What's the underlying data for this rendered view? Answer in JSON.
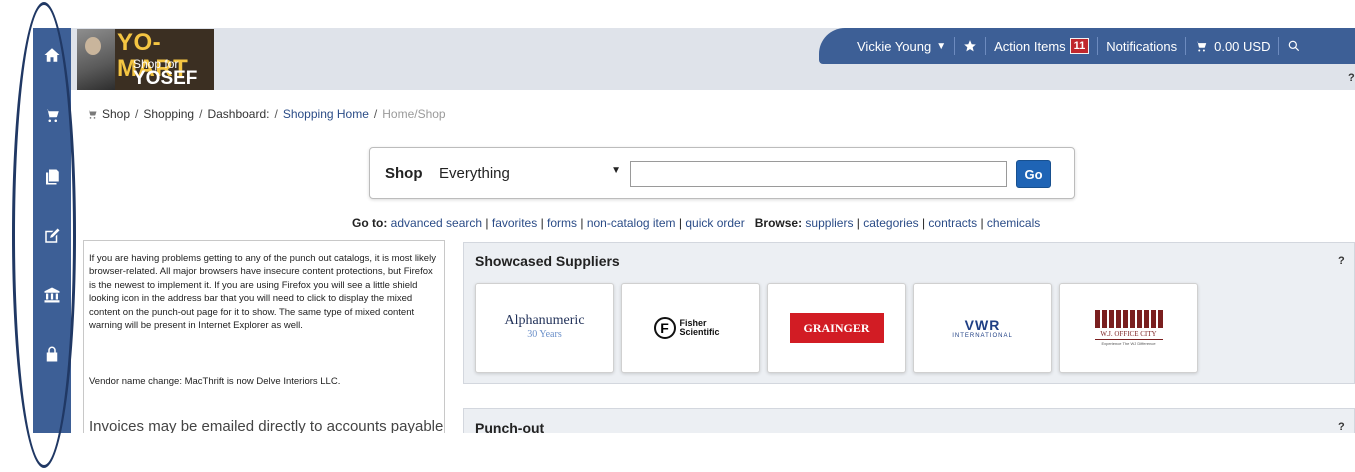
{
  "header": {
    "logo": {
      "title": "YO-MART",
      "subtitle": "Shop for",
      "name": "YOSEF"
    },
    "user_bar": {
      "user_name": "Vickie Young",
      "action_items_label": "Action Items",
      "action_items_count": "11",
      "notifications_label": "Notifications",
      "cart_total": "0.00 USD"
    },
    "help": "?"
  },
  "sidebar": {
    "items": [
      {
        "name": "home",
        "icon": "home-icon"
      },
      {
        "name": "shop",
        "icon": "cart-icon"
      },
      {
        "name": "documents",
        "icon": "documents-icon"
      },
      {
        "name": "approvals",
        "icon": "edit-icon"
      },
      {
        "name": "accounts-payable",
        "icon": "bank-icon"
      },
      {
        "name": "setup",
        "icon": "lock-icon"
      }
    ]
  },
  "breadcrumb": {
    "shop": "Shop",
    "shopping": "Shopping",
    "dashboard": "Dashboard:",
    "shopping_home": "Shopping Home",
    "current": "Home/Shop"
  },
  "search": {
    "label": "Shop",
    "category": "Everything",
    "query": "",
    "go_label": "Go"
  },
  "goto": {
    "label": "Go to:",
    "links": [
      "advanced search",
      "favorites",
      "forms",
      "non-catalog item",
      "quick order"
    ],
    "browse_label": "Browse:",
    "browse_links": [
      "suppliers",
      "categories",
      "contracts",
      "chemicals"
    ]
  },
  "info": {
    "paragraph1": "If you are having problems getting to any of the punch out catalogs, it is most likely browser-related. All major browsers have insecure content protections, but Firefox is the newest to implement it. If you are using Firefox you will see a little shield looking icon in the address bar that you will need to click to display the mixed content on the punch-out page for it to show. The same type of mixed content warning will be present in Internet Explorer as well.",
    "paragraph2": "Vendor name change:  MacThrift is now Delve Interiors LLC.",
    "paragraph3": "Invoices may be emailed directly to accounts payable"
  },
  "showcase": {
    "title": "Showcased Suppliers",
    "help": "?",
    "suppliers": [
      {
        "name": "Alphanumeric",
        "logo_text": "Alphanumeric",
        "logo_sub": "30 Years"
      },
      {
        "name": "Fisher Scientific",
        "logo_text": "Fisher Scientific"
      },
      {
        "name": "Grainger",
        "logo_text": "GRAINGER"
      },
      {
        "name": "VWR International",
        "logo_text": "VWR",
        "logo_sub": "INTERNATIONAL"
      },
      {
        "name": "W.J. Office City",
        "logo_text": "W.J. OFFICE CITY",
        "logo_sub": "Experience The WJ Difference"
      }
    ]
  },
  "punchout": {
    "title": "Punch-out",
    "help": "?"
  },
  "colors": {
    "nav_blue": "#3d5f96",
    "link_blue": "#2b4c87",
    "go_blue": "#1f64b5",
    "badge_red": "#c0272d",
    "annotation": "#203864"
  }
}
